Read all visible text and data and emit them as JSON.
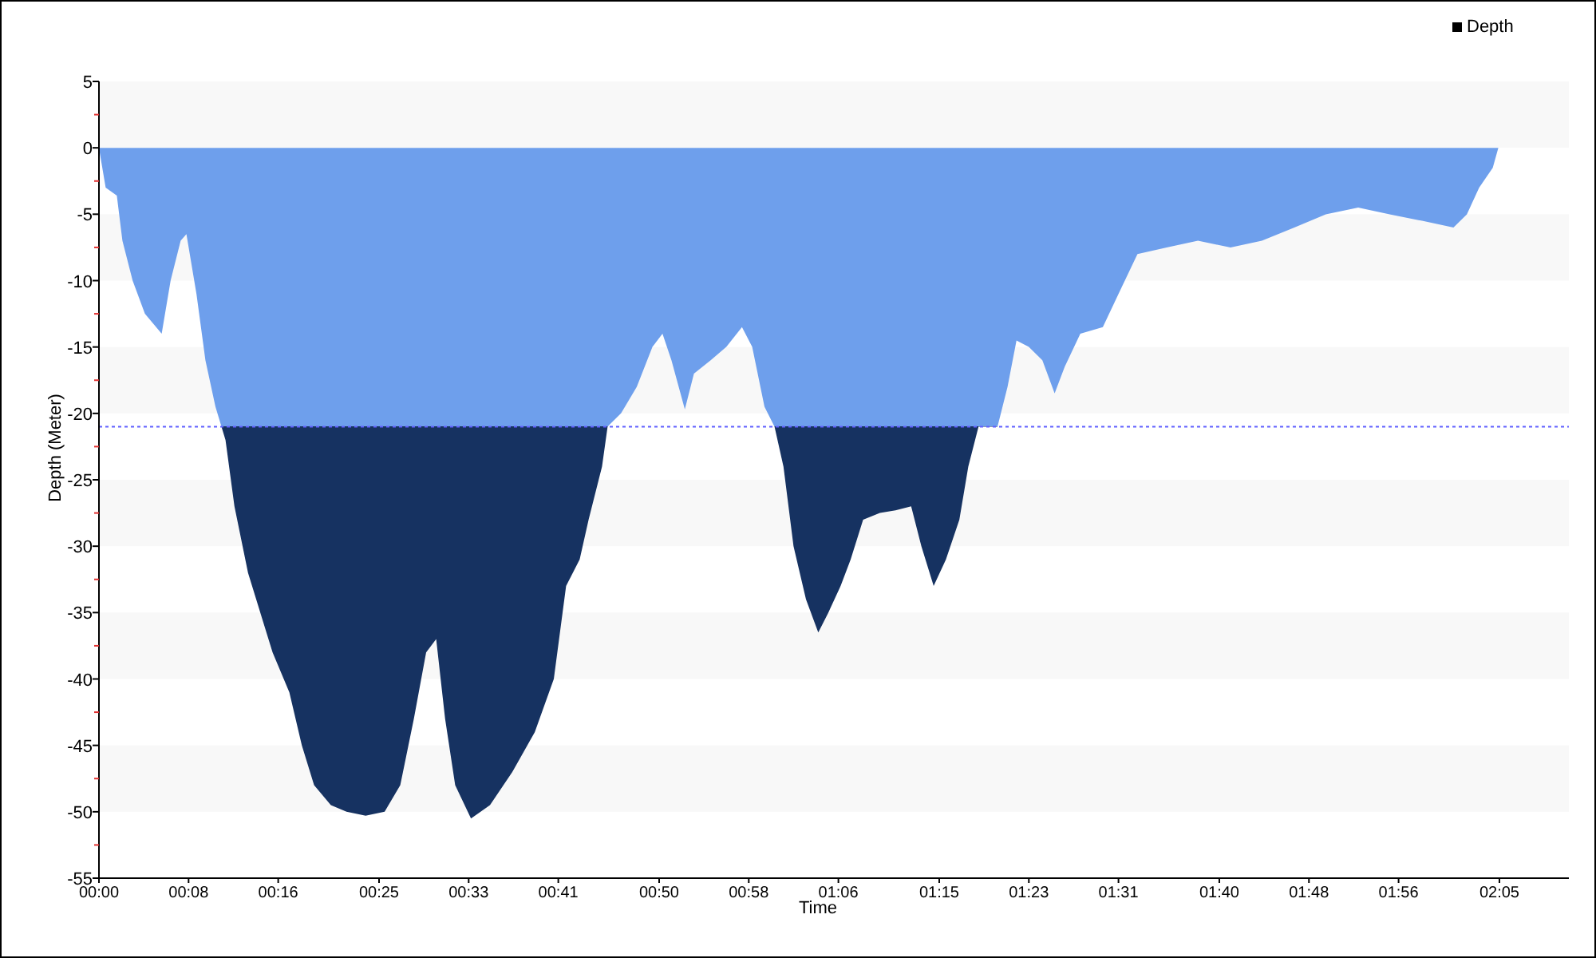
{
  "chart_data": {
    "type": "area",
    "xlabel": "Time",
    "ylabel": "Depth (Meter)",
    "xlim": [
      0,
      131.2
    ],
    "ylim": [
      -55,
      5
    ],
    "x": [
      0,
      0.6,
      1.6,
      2.1,
      3.0,
      4.1,
      5.6,
      6.4,
      7.3,
      7.8,
      8.7,
      9.5,
      10.4,
      11.3,
      12.1,
      13.3,
      14.4,
      15.5,
      17.0,
      18.1,
      19.2,
      20.7,
      22.1,
      23.8,
      25.5,
      26.9,
      28.1,
      29.2,
      30.1,
      30.9,
      31.8,
      33.2,
      34.9,
      36.9,
      38.9,
      40.6,
      41.7,
      42.9,
      43.7,
      44.9,
      45.4,
      46.6,
      48.0,
      49.4,
      50.3,
      51.1,
      52.3,
      53.1,
      54.6,
      56.0,
      57.4,
      58.3,
      59.4,
      60.3,
      61.1,
      62.0,
      63.1,
      64.2,
      65.1,
      66.2,
      67.1,
      68.2,
      69.7,
      71.1,
      72.5,
      73.4,
      74.5,
      75.6,
      76.8,
      77.6,
      78.5,
      80.2,
      81.1,
      81.9,
      83.0,
      84.2,
      85.3,
      86.2,
      87.6,
      89.6,
      91.0,
      92.7,
      95.3,
      98.1,
      101.0,
      103.8,
      106.7,
      109.5,
      112.4,
      115.2,
      118.1,
      120.9,
      122.1,
      123.2,
      124.4,
      124.9
    ],
    "series": [
      {
        "name": "Depth",
        "color": "#6e9fec",
        "values": [
          0,
          -3,
          -3.6,
          -7,
          -10,
          -12.5,
          -14,
          -10,
          -7,
          -6.5,
          -11,
          -16,
          -19.5,
          -22,
          -27,
          -32,
          -35,
          -38,
          -41,
          -45,
          -48,
          -49.5,
          -50,
          -50.3,
          -50,
          -48,
          -43,
          -38,
          -37,
          -43,
          -48,
          -50.5,
          -49.5,
          -47,
          -44,
          -40,
          -33,
          -31,
          -28,
          -24,
          -21,
          -20,
          -18,
          -15,
          -14,
          -16,
          -19.7,
          -17,
          -16,
          -15,
          -13.5,
          -15,
          -19.5,
          -21,
          -24,
          -30,
          -34,
          -36.5,
          -35,
          -33,
          -31,
          -28,
          -27.5,
          -27.3,
          -27,
          -30,
          -33,
          -31,
          -28,
          -24,
          -21,
          -21,
          -18,
          -14.5,
          -15,
          -16,
          -18.5,
          -16.5,
          -14,
          -13.5,
          -11,
          -8,
          -7.5,
          -7,
          -7.5,
          -7,
          -6,
          -5,
          -4.5,
          -5,
          -5.5,
          -6,
          -5,
          -3,
          -1.5,
          0
        ]
      }
    ],
    "yticks": [
      5,
      0,
      -5,
      -10,
      -15,
      -20,
      -25,
      -30,
      -35,
      -40,
      -45,
      -50,
      -55
    ],
    "xticks": [
      {
        "value": 0,
        "label": "00:00"
      },
      {
        "value": 8,
        "label": "00:08"
      },
      {
        "value": 16,
        "label": "00:16"
      },
      {
        "value": 25,
        "label": "00:25"
      },
      {
        "value": 33,
        "label": "00:33"
      },
      {
        "value": 41,
        "label": "00:41"
      },
      {
        "value": 50,
        "label": "00:50"
      },
      {
        "value": 58,
        "label": "00:58"
      },
      {
        "value": 66,
        "label": "01:06"
      },
      {
        "value": 75,
        "label": "01:15"
      },
      {
        "value": 83,
        "label": "01:23"
      },
      {
        "value": 91,
        "label": "01:31"
      },
      {
        "value": 100,
        "label": "01:40"
      },
      {
        "value": 108,
        "label": "01:48"
      },
      {
        "value": 116,
        "label": "01:56"
      },
      {
        "value": 125,
        "label": "02:05"
      }
    ],
    "ref_lines": [
      {
        "axis": "y",
        "value": -21,
        "color": "#6060ff"
      }
    ]
  }
}
